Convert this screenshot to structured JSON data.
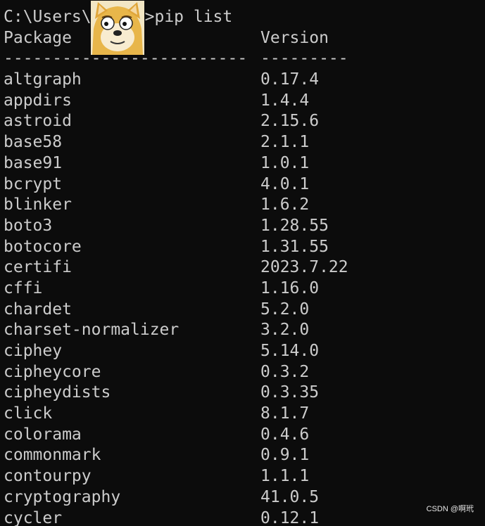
{
  "prompt": {
    "path_start": "C:\\Users\\",
    "path_end": ">pip list"
  },
  "table": {
    "header_package": "Package",
    "header_version": "Version",
    "separator_package": "-------------------------",
    "separator_version": "---------",
    "rows": [
      {
        "package": "altgraph",
        "version": "0.17.4"
      },
      {
        "package": "appdirs",
        "version": "1.4.4"
      },
      {
        "package": "astroid",
        "version": "2.15.6"
      },
      {
        "package": "base58",
        "version": "2.1.1"
      },
      {
        "package": "base91",
        "version": "1.0.1"
      },
      {
        "package": "bcrypt",
        "version": "4.0.1"
      },
      {
        "package": "blinker",
        "version": "1.6.2"
      },
      {
        "package": "boto3",
        "version": "1.28.55"
      },
      {
        "package": "botocore",
        "version": "1.31.55"
      },
      {
        "package": "certifi",
        "version": "2023.7.22"
      },
      {
        "package": "cffi",
        "version": "1.16.0"
      },
      {
        "package": "chardet",
        "version": "5.2.0"
      },
      {
        "package": "charset-normalizer",
        "version": "3.2.0"
      },
      {
        "package": "ciphey",
        "version": "5.14.0"
      },
      {
        "package": "cipheycore",
        "version": "0.3.2"
      },
      {
        "package": "cipheydists",
        "version": "0.3.35"
      },
      {
        "package": "click",
        "version": "8.1.7"
      },
      {
        "package": "colorama",
        "version": "0.4.6"
      },
      {
        "package": "commonmark",
        "version": "0.9.1"
      },
      {
        "package": "contourpy",
        "version": "1.1.1"
      },
      {
        "package": "cryptography",
        "version": "41.0.5"
      },
      {
        "package": "cycler",
        "version": "0.12.1"
      }
    ]
  },
  "avatar": {
    "icon": "doge-avatar-icon",
    "fur_color": "#e8b64a"
  },
  "watermark": {
    "text": "CSDN @啊玳"
  },
  "colors": {
    "background": "#0c0c0c",
    "foreground": "#cccccc"
  }
}
